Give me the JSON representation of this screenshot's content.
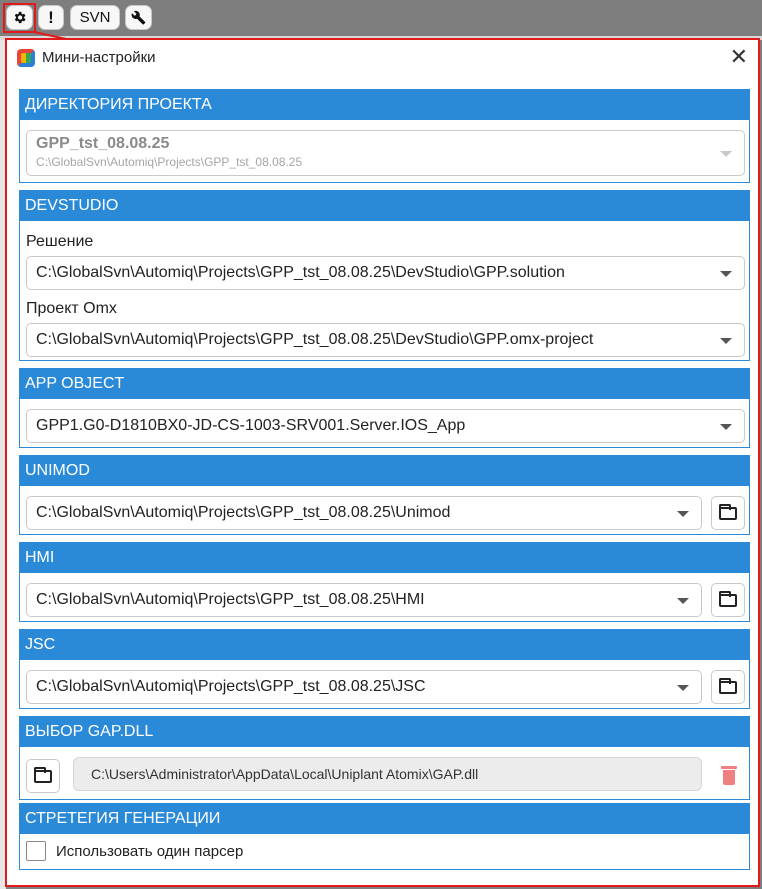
{
  "toolbar": {
    "excl_label": "!",
    "svn_label": "SVN"
  },
  "dialog": {
    "title": "Мини-настройки",
    "close_label": "✕"
  },
  "sections": {
    "project_dir": {
      "header": "ДИРЕКТОРИЯ ПРОЕКТА",
      "name": "GPP_tst_08.08.25",
      "path": "C:\\GlobalSvn\\Automiq\\Projects\\GPP_tst_08.08.25"
    },
    "devstudio": {
      "header": "DEVSTUDIO",
      "solution_label": "Решение",
      "solution_value": "C:\\GlobalSvn\\Automiq\\Projects\\GPP_tst_08.08.25\\DevStudio\\GPP.solution",
      "project_label": "Проект Omx",
      "project_value": "C:\\GlobalSvn\\Automiq\\Projects\\GPP_tst_08.08.25\\DevStudio\\GPP.omx-project"
    },
    "app_object": {
      "header": "APP OBJECT",
      "value": "GPP1.G0-D1810BX0-JD-CS-1003-SRV001.Server.IOS_App"
    },
    "unimod": {
      "header": "UNIMOD",
      "value": "C:\\GlobalSvn\\Automiq\\Projects\\GPP_tst_08.08.25\\Unimod"
    },
    "hmi": {
      "header": "HMI",
      "value": "C:\\GlobalSvn\\Automiq\\Projects\\GPP_tst_08.08.25\\HMI"
    },
    "jsc": {
      "header": "JSC",
      "value": "C:\\GlobalSvn\\Automiq\\Projects\\GPP_tst_08.08.25\\JSC"
    },
    "gap_dll": {
      "header": "ВЫБОР GAP.DLL",
      "path": "C:\\Users\\Administrator\\AppData\\Local\\Uniplant Atomix\\GAP.dll"
    },
    "generation": {
      "header": "СТРЕТЕГИЯ ГЕНЕРАЦИИ",
      "checkbox_label": "Использовать один парсер",
      "checked": false
    }
  },
  "colors": {
    "accent": "#2b8ad8",
    "highlight": "#e01a1a",
    "delete": "#f08080"
  },
  "icons": [
    "gear-icon",
    "wrench-icon",
    "folder-icon",
    "trash-icon",
    "chevron-down-icon",
    "close-icon",
    "app-logo-icon"
  ]
}
